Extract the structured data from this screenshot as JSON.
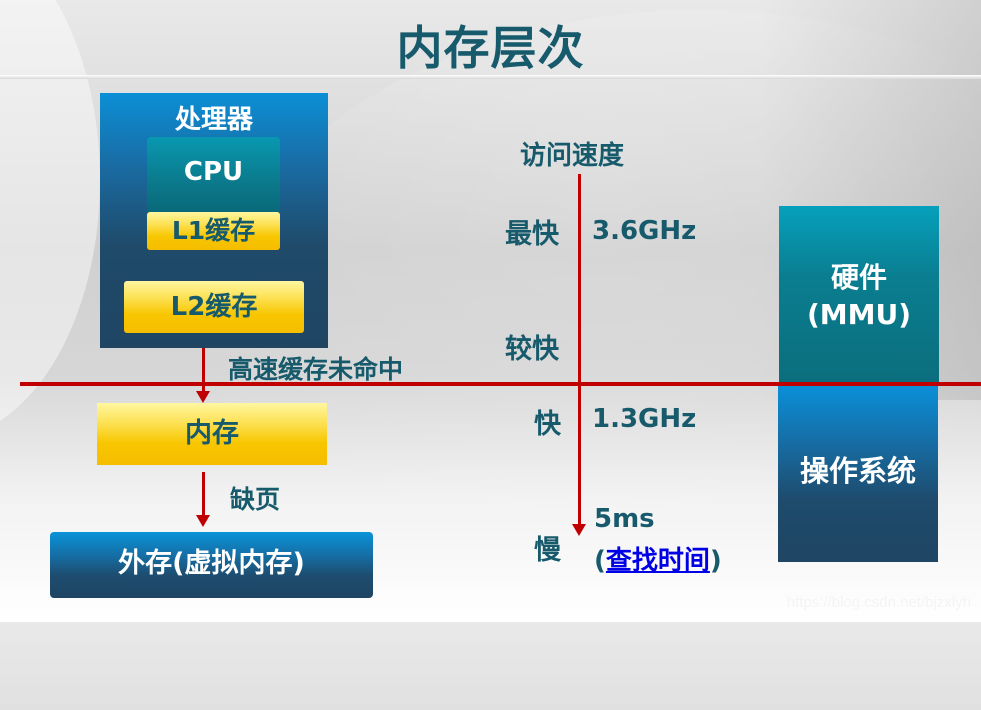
{
  "title": "内存层次",
  "hierarchy": {
    "processor": {
      "label": "处理器",
      "cpu": "CPU",
      "l1_cache": "L1缓存",
      "l2_cache": "L2缓存"
    },
    "cache_miss_label": "高速缓存未命中",
    "memory": "内存",
    "page_fault_label": "缺页",
    "storage": "外存(虚拟内存)"
  },
  "speed_axis": {
    "title": "访问速度",
    "levels": [
      {
        "label": "最快",
        "value": "3.6GHz"
      },
      {
        "label": "较快",
        "value": ""
      },
      {
        "label": "快",
        "value": "1.3GHz"
      },
      {
        "label": "慢",
        "value": "5ms",
        "note_prefix": "(",
        "note_link": "查找时间",
        "note_suffix": ")"
      }
    ]
  },
  "management": {
    "hardware_line1": "硬件",
    "hardware_line2": "(MMU)",
    "os": "操作系统"
  },
  "colors": {
    "accent_red": "#c00000",
    "text_teal": "#175a6c",
    "gold": "#f8c600",
    "blue": "#1f4563",
    "link": "#0000e6"
  },
  "watermark": "https://blog.csdn.net/bjzxlyh"
}
